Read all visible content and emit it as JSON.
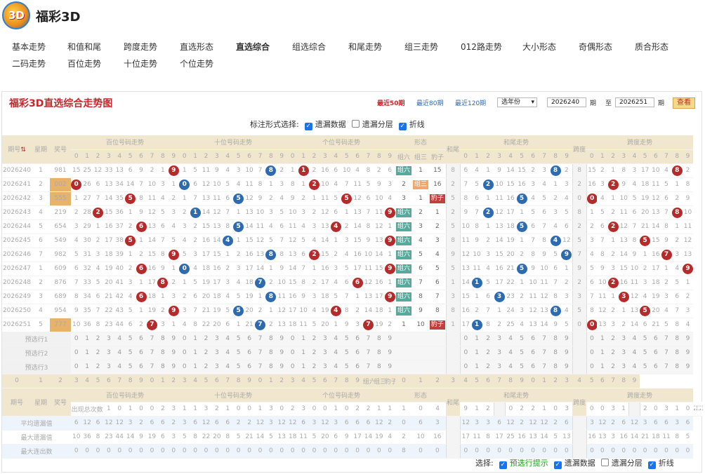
{
  "app": {
    "logo_text": "3D",
    "brand": "福彩3D"
  },
  "nav": [
    [
      "基本走势",
      "和值和尾",
      "跨度走势",
      "直选形态",
      "直选综合",
      "组选综合",
      "和尾走势",
      "组三走势",
      "012路走势",
      "大小形态",
      "奇偶形态",
      "质合形态"
    ],
    [
      "二码走势",
      "百位走势",
      "十位走势",
      "个位走势"
    ]
  ],
  "nav_active": "直选综合",
  "panel": {
    "title": "福彩3D直选综合走势图",
    "recent": [
      "最近50期",
      "最近80期",
      "最近120期"
    ],
    "year_select": "选年份",
    "from": "2026240",
    "to": "2026251",
    "qi": "期",
    "zhi": "至",
    "query": "查看"
  },
  "options": {
    "label": "标注形式选择:",
    "items": [
      [
        "遗漏数据",
        true
      ],
      [
        "遗漏分层",
        false
      ],
      [
        "折线",
        true
      ]
    ]
  },
  "head": {
    "issue": "期号",
    "week": "星期",
    "prize": "奖号",
    "bai": "百位号码走势",
    "shi": "十位号码走势",
    "ge": "个位号码走势",
    "form": "形态",
    "form6": "组六",
    "form3": "组三",
    "formb": "豹子",
    "sum_tail": "和尾",
    "sum_tail_trend": "和尾走势",
    "span": "跨度",
    "span_trend": "跨度走势",
    "digits": [
      "0",
      "1",
      "2",
      "3",
      "4",
      "5",
      "6",
      "7",
      "8",
      "9"
    ]
  },
  "rows": [
    {
      "issue": "2026240",
      "week": "1",
      "prize": "981",
      "hot": false,
      "bai": [
        "15",
        "25",
        "12",
        "33",
        "13",
        "6",
        "9",
        "2",
        "1",
        "9"
      ],
      "shi": [
        "1",
        "5",
        "11",
        "9",
        "4",
        "3",
        "10",
        "7",
        "8",
        "2"
      ],
      "ge": [
        "1",
        "1",
        "2",
        "16",
        "6",
        "10",
        "4",
        "8",
        "2",
        "6"
      ],
      "form": [
        "组六",
        "1",
        "15"
      ],
      "sum_tail": "8",
      "st": [
        "6",
        "4",
        "1",
        "9",
        "14",
        "15",
        "2",
        "3",
        "8",
        "2"
      ],
      "span": "8",
      "sp": [
        "15",
        "2",
        "1",
        "8",
        "3",
        "17",
        "10",
        "4",
        "8",
        "2"
      ]
    },
    {
      "issue": "2026241",
      "week": "2",
      "prize": "002",
      "hot": true,
      "bai": [
        "0",
        "26",
        "6",
        "13",
        "34",
        "14",
        "7",
        "10",
        "3",
        "1"
      ],
      "shi": [
        "0",
        "6",
        "12",
        "10",
        "5",
        "4",
        "11",
        "8",
        "1",
        "3"
      ],
      "ge": [
        "8",
        "1",
        "2",
        "10",
        "4",
        "7",
        "11",
        "5",
        "9",
        "3"
      ],
      "form": [
        "2",
        "组三",
        "16"
      ],
      "sum_tail": "2",
      "st": [
        "7",
        "5",
        "2",
        "10",
        "15",
        "16",
        "3",
        "4",
        "1",
        "3"
      ],
      "span": "2",
      "sp": [
        "16",
        "3",
        "2",
        "9",
        "4",
        "18",
        "11",
        "5",
        "1",
        "8"
      ]
    },
    {
      "issue": "2026242",
      "week": "3",
      "prize": "555",
      "hot": true,
      "bai": [
        "1",
        "27",
        "7",
        "14",
        "35",
        "5",
        "8",
        "11",
        "4",
        "2"
      ],
      "shi": [
        "1",
        "7",
        "13",
        "11",
        "6",
        "5",
        "12",
        "9",
        "2",
        "4"
      ],
      "ge": [
        "9",
        "2",
        "1",
        "11",
        "5",
        "5",
        "12",
        "6",
        "10",
        "4"
      ],
      "form": [
        "3",
        "1",
        "豹子"
      ],
      "sum_tail": "5",
      "st": [
        "8",
        "6",
        "1",
        "11",
        "16",
        "5",
        "4",
        "5",
        "2",
        "4"
      ],
      "span": "0",
      "sp": [
        "0",
        "4",
        "1",
        "10",
        "5",
        "19",
        "12",
        "6",
        "2",
        "9"
      ]
    },
    {
      "issue": "2026243",
      "week": "4",
      "prize": "219",
      "hot": false,
      "bai": [
        "2",
        "28",
        "2",
        "15",
        "36",
        "1",
        "9",
        "12",
        "5",
        "3"
      ],
      "shi": [
        "2",
        "1",
        "14",
        "12",
        "7",
        "1",
        "13",
        "10",
        "3",
        "5"
      ],
      "ge": [
        "10",
        "3",
        "2",
        "12",
        "6",
        "1",
        "13",
        "7",
        "11",
        "9"
      ],
      "form": [
        "组六",
        "2",
        "1"
      ],
      "sum_tail": "2",
      "st": [
        "9",
        "7",
        "2",
        "12",
        "17",
        "1",
        "5",
        "6",
        "3",
        "5"
      ],
      "span": "8",
      "sp": [
        "1",
        "5",
        "2",
        "11",
        "6",
        "20",
        "13",
        "7",
        "8",
        "10"
      ]
    },
    {
      "issue": "2026244",
      "week": "5",
      "prize": "654",
      "hot": false,
      "bai": [
        "3",
        "29",
        "1",
        "16",
        "37",
        "2",
        "6",
        "13",
        "6",
        "4"
      ],
      "shi": [
        "3",
        "2",
        "15",
        "13",
        "8",
        "5",
        "14",
        "11",
        "4",
        "6"
      ],
      "ge": [
        "11",
        "4",
        "3",
        "13",
        "4",
        "2",
        "14",
        "8",
        "12",
        "1"
      ],
      "form": [
        "组六",
        "3",
        "2"
      ],
      "sum_tail": "5",
      "st": [
        "10",
        "8",
        "1",
        "13",
        "18",
        "5",
        "6",
        "7",
        "4",
        "6"
      ],
      "span": "2",
      "sp": [
        "2",
        "6",
        "2",
        "12",
        "7",
        "21",
        "14",
        "8",
        "1",
        "11"
      ]
    },
    {
      "issue": "2026245",
      "week": "6",
      "prize": "549",
      "hot": false,
      "bai": [
        "4",
        "30",
        "2",
        "17",
        "38",
        "5",
        "1",
        "14",
        "7",
        "5"
      ],
      "shi": [
        "4",
        "2",
        "16",
        "14",
        "4",
        "1",
        "15",
        "12",
        "5",
        "7"
      ],
      "ge": [
        "12",
        "5",
        "4",
        "14",
        "1",
        "3",
        "15",
        "9",
        "13",
        "9"
      ],
      "form": [
        "组六",
        "4",
        "3"
      ],
      "sum_tail": "8",
      "st": [
        "11",
        "9",
        "2",
        "14",
        "19",
        "1",
        "7",
        "8",
        "4",
        "12"
      ],
      "span": "5",
      "sp": [
        "3",
        "7",
        "1",
        "13",
        "8",
        "5",
        "15",
        "9",
        "2",
        "12"
      ]
    },
    {
      "issue": "2026246",
      "week": "7",
      "prize": "982",
      "hot": false,
      "bai": [
        "5",
        "31",
        "3",
        "18",
        "39",
        "1",
        "2",
        "15",
        "8",
        "9"
      ],
      "shi": [
        "5",
        "3",
        "17",
        "15",
        "1",
        "2",
        "16",
        "13",
        "8",
        "8"
      ],
      "ge": [
        "13",
        "6",
        "2",
        "15",
        "2",
        "4",
        "16",
        "10",
        "14",
        "1"
      ],
      "form": [
        "组六",
        "5",
        "4"
      ],
      "sum_tail": "9",
      "st": [
        "12",
        "10",
        "3",
        "15",
        "20",
        "2",
        "8",
        "9",
        "5",
        "9"
      ],
      "span": "7",
      "sp": [
        "4",
        "8",
        "2",
        "14",
        "9",
        "1",
        "16",
        "7",
        "3",
        "13"
      ]
    },
    {
      "issue": "2026247",
      "week": "1",
      "prize": "609",
      "hot": false,
      "bai": [
        "6",
        "32",
        "4",
        "19",
        "40",
        "2",
        "6",
        "16",
        "9",
        "1"
      ],
      "shi": [
        "0",
        "4",
        "18",
        "16",
        "2",
        "3",
        "17",
        "14",
        "1",
        "9"
      ],
      "ge": [
        "14",
        "7",
        "1",
        "16",
        "3",
        "5",
        "17",
        "11",
        "15",
        "9"
      ],
      "form": [
        "组六",
        "6",
        "5"
      ],
      "sum_tail": "5",
      "st": [
        "13",
        "11",
        "4",
        "16",
        "21",
        "5",
        "9",
        "10",
        "6",
        "1"
      ],
      "span": "9",
      "sp": [
        "5",
        "9",
        "3",
        "15",
        "10",
        "2",
        "17",
        "1",
        "4",
        "9"
      ]
    },
    {
      "issue": "2026248",
      "week": "2",
      "prize": "876",
      "hot": false,
      "bai": [
        "7",
        "33",
        "5",
        "20",
        "41",
        "3",
        "1",
        "17",
        "8",
        "2"
      ],
      "shi": [
        "1",
        "5",
        "19",
        "17",
        "3",
        "4",
        "18",
        "7",
        "2",
        "10"
      ],
      "ge": [
        "15",
        "8",
        "2",
        "17",
        "4",
        "6",
        "6",
        "12",
        "16",
        "1"
      ],
      "form": [
        "组六",
        "7",
        "6"
      ],
      "sum_tail": "1",
      "st": [
        "14",
        "1",
        "5",
        "17",
        "22",
        "1",
        "10",
        "11",
        "7",
        "2"
      ],
      "span": "2",
      "sp": [
        "6",
        "10",
        "2",
        "16",
        "11",
        "3",
        "18",
        "2",
        "5",
        "1"
      ]
    },
    {
      "issue": "2026249",
      "week": "3",
      "prize": "689",
      "hot": false,
      "bai": [
        "8",
        "34",
        "6",
        "21",
        "42",
        "4",
        "6",
        "18",
        "1",
        "3"
      ],
      "shi": [
        "2",
        "6",
        "20",
        "18",
        "4",
        "5",
        "19",
        "1",
        "8",
        "11"
      ],
      "ge": [
        "16",
        "9",
        "3",
        "18",
        "5",
        "7",
        "1",
        "13",
        "17",
        "9"
      ],
      "form": [
        "组六",
        "8",
        "7"
      ],
      "sum_tail": "3",
      "st": [
        "15",
        "1",
        "6",
        "3",
        "23",
        "2",
        "11",
        "12",
        "8",
        "3"
      ],
      "span": "3",
      "sp": [
        "7",
        "11",
        "1",
        "3",
        "12",
        "4",
        "19",
        "3",
        "6",
        "2"
      ]
    },
    {
      "issue": "2026250",
      "week": "4",
      "prize": "954",
      "hot": false,
      "bai": [
        "9",
        "35",
        "7",
        "22",
        "43",
        "5",
        "1",
        "19",
        "2",
        "9"
      ],
      "shi": [
        "3",
        "7",
        "21",
        "19",
        "5",
        "5",
        "20",
        "2",
        "1",
        "12"
      ],
      "ge": [
        "17",
        "10",
        "4",
        "19",
        "4",
        "8",
        "2",
        "14",
        "18",
        "1"
      ],
      "form": [
        "组六",
        "9",
        "8"
      ],
      "sum_tail": "8",
      "st": [
        "16",
        "2",
        "7",
        "1",
        "24",
        "3",
        "12",
        "13",
        "8",
        "4"
      ],
      "span": "5",
      "sp": [
        "8",
        "12",
        "2",
        "1",
        "13",
        "5",
        "20",
        "4",
        "7",
        "3"
      ]
    },
    {
      "issue": "2026251",
      "week": "5",
      "prize": "777",
      "hot": true,
      "bai": [
        "10",
        "36",
        "8",
        "23",
        "44",
        "6",
        "2",
        "7",
        "3",
        "1"
      ],
      "shi": [
        "4",
        "8",
        "22",
        "20",
        "6",
        "1",
        "21",
        "7",
        "2",
        "13"
      ],
      "ge": [
        "18",
        "11",
        "5",
        "20",
        "1",
        "9",
        "3",
        "7",
        "19",
        "2"
      ],
      "form": [
        "1",
        "10",
        "豹子"
      ],
      "sum_tail": "1",
      "st": [
        "17",
        "1",
        "8",
        "2",
        "25",
        "4",
        "13",
        "14",
        "9",
        "5"
      ],
      "span": "0",
      "sp": [
        "0",
        "13",
        "3",
        "2",
        "14",
        "6",
        "21",
        "5",
        "8",
        "4"
      ]
    }
  ],
  "hits": {
    "bai": [
      [
        9,
        "r"
      ],
      [
        0,
        "r"
      ],
      [
        5,
        "r"
      ],
      [
        2,
        "r"
      ],
      [
        6,
        "r"
      ],
      [
        5,
        "r"
      ],
      [
        9,
        "r"
      ],
      [
        6,
        "r"
      ],
      [
        8,
        "r"
      ],
      [
        6,
        "r"
      ],
      [
        9,
        "r"
      ],
      [
        7,
        "r"
      ]
    ],
    "shi": [
      [
        8,
        "b"
      ],
      [
        0,
        "b"
      ],
      [
        5,
        "b"
      ],
      [
        1,
        "b"
      ],
      [
        5,
        "b"
      ],
      [
        4,
        "b"
      ],
      [
        8,
        "b"
      ],
      [
        0,
        "b"
      ],
      [
        7,
        "b"
      ],
      [
        8,
        "b"
      ],
      [
        5,
        "b"
      ],
      [
        7,
        "b"
      ]
    ],
    "ge": [
      [
        1,
        "r"
      ],
      [
        2,
        "r"
      ],
      [
        5,
        "r"
      ],
      [
        9,
        "r"
      ],
      [
        4,
        "r"
      ],
      [
        9,
        "r"
      ],
      [
        2,
        "r"
      ],
      [
        9,
        "r"
      ],
      [
        6,
        "r"
      ],
      [
        9,
        "r"
      ],
      [
        4,
        "r"
      ],
      [
        7,
        "r"
      ]
    ],
    "st": [
      [
        8,
        "b"
      ],
      [
        2,
        "b"
      ],
      [
        5,
        "b"
      ],
      [
        2,
        "b"
      ],
      [
        5,
        "b"
      ],
      [
        8,
        "b"
      ],
      [
        9,
        "b"
      ],
      [
        5,
        "b"
      ],
      [
        1,
        "b"
      ],
      [
        3,
        "b"
      ],
      [
        8,
        "b"
      ],
      [
        1,
        "b"
      ]
    ],
    "sp": [
      [
        8,
        "r"
      ],
      [
        2,
        "r"
      ],
      [
        0,
        "r"
      ],
      [
        8,
        "r"
      ],
      [
        2,
        "r"
      ],
      [
        5,
        "r"
      ],
      [
        7,
        "r"
      ],
      [
        9,
        "r"
      ],
      [
        2,
        "r"
      ],
      [
        3,
        "r"
      ],
      [
        5,
        "r"
      ],
      [
        0,
        "r"
      ]
    ]
  },
  "presel": [
    "预选行1",
    "预选行2",
    "预选行3"
  ],
  "stats": [
    {
      "label": "出现总次数",
      "bai": [
        "1",
        "0",
        "1",
        "0",
        "0",
        "2",
        "3",
        "1",
        "1",
        "3"
      ],
      "shi": [
        "2",
        "1",
        "0",
        "0",
        "1",
        "3",
        "0",
        "2",
        "3",
        "0"
      ],
      "ge": [
        "0",
        "1",
        "0",
        "2",
        "2",
        "1",
        "1",
        "1",
        "0",
        "4"
      ],
      "form": [
        "9",
        "1",
        "2"
      ],
      "st": [
        "0",
        "2",
        "2",
        "1",
        "0",
        "3",
        "0",
        "0",
        "3",
        "1"
      ],
      "sp": [
        "2",
        "0",
        "3",
        "1",
        "0",
        "2",
        "1",
        "1",
        "2",
        "1"
      ]
    },
    {
      "label": "平均遗漏值",
      "bai": [
        "6",
        "12",
        "6",
        "12",
        "12",
        "3",
        "2",
        "6",
        "6",
        "2"
      ],
      "shi": [
        "3",
        "6",
        "12",
        "6",
        "6",
        "2",
        "2",
        "12",
        "3",
        "12"
      ],
      "ge": [
        "12",
        "6",
        "3",
        "12",
        "3",
        "6",
        "6",
        "6",
        "12",
        "2"
      ],
      "form": [
        "0",
        "6",
        "3"
      ],
      "st": [
        "12",
        "3",
        "3",
        "6",
        "12",
        "2",
        "12",
        "12",
        "2",
        "6"
      ],
      "sp": [
        "3",
        "12",
        "2",
        "6",
        "12",
        "3",
        "6",
        "6",
        "3",
        "6"
      ]
    },
    {
      "label": "最大遗漏值",
      "bai": [
        "10",
        "36",
        "8",
        "23",
        "44",
        "14",
        "9",
        "19",
        "6",
        "3"
      ],
      "shi": [
        "5",
        "8",
        "22",
        "20",
        "8",
        "5",
        "21",
        "14",
        "5",
        "13"
      ],
      "ge": [
        "18",
        "11",
        "5",
        "20",
        "6",
        "9",
        "17",
        "14",
        "19",
        "4"
      ],
      "form": [
        "2",
        "10",
        "16"
      ],
      "st": [
        "17",
        "11",
        "8",
        "17",
        "25",
        "16",
        "13",
        "14",
        "5",
        "13"
      ],
      "sp": [
        "16",
        "13",
        "3",
        "16",
        "14",
        "21",
        "18",
        "11",
        "8",
        "5"
      ]
    },
    {
      "label": "最大连出数",
      "bai": [
        "0",
        "0",
        "0",
        "0",
        "0",
        "0",
        "0",
        "0",
        "0",
        "0"
      ],
      "shi": [
        "0",
        "0",
        "0",
        "0",
        "0",
        "0",
        "0",
        "0",
        "0",
        "0"
      ],
      "ge": [
        "0",
        "0",
        "0",
        "0",
        "0",
        "0",
        "0",
        "0",
        "0",
        "0"
      ],
      "form": [
        "8",
        "0",
        "0"
      ],
      "st": [
        "0",
        "0",
        "0",
        "0",
        "0",
        "0",
        "0",
        "0",
        "0",
        "0"
      ],
      "sp": [
        "0",
        "0",
        "0",
        "0",
        "0",
        "0",
        "0",
        "0",
        "0",
        "0"
      ]
    }
  ],
  "footer": {
    "label": "选择:",
    "items": [
      [
        "预选行提示",
        true,
        "#1a9a1a"
      ],
      [
        "遗漏数据",
        true,
        "#333"
      ],
      [
        "遗漏分层",
        false,
        "#333"
      ],
      [
        "折线",
        true,
        "#333"
      ]
    ]
  },
  "colors": {
    "red": "#b52a2a",
    "blue": "#2e6aae",
    "header_bg": "#f1e7ce",
    "title_red": "#c8262a"
  }
}
